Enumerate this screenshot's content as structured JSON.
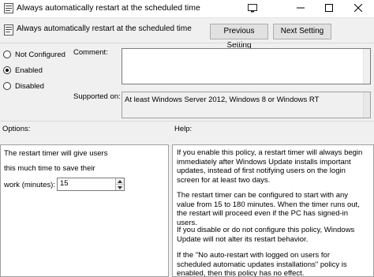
{
  "window": {
    "title": "Always automatically restart at the scheduled time"
  },
  "header": {
    "policy_name": "Always automatically restart at the scheduled time",
    "prev_label": "Previous Setting",
    "next_label": "Next Setting"
  },
  "state": {
    "options": [
      "Not Configured",
      "Enabled",
      "Disabled"
    ],
    "selected": "Enabled"
  },
  "comment": {
    "label": "Comment:",
    "value": ""
  },
  "supported": {
    "label": "Supported on:",
    "value": "At least Windows Server 2012, Windows 8 or Windows RT"
  },
  "options_panel": {
    "label": "Options:",
    "line1": "The restart timer will give users",
    "line2": "this much time to save their",
    "line3": "work (minutes):",
    "minutes_value": "15"
  },
  "help_panel": {
    "label": "Help:",
    "paragraphs": [
      "If you enable this policy, a restart timer will always begin immediately after Windows Update installs important updates, instead of first notifying users on the login screen for at least two days.",
      "The restart timer can be configured to start with any value from 15 to 180 minutes. When the timer runs out, the restart will proceed even if the PC has signed-in users.",
      "If you disable or do not configure this policy, Windows Update will not alter its restart behavior.",
      "If the \"No auto-restart with logged on users for scheduled automatic updates installations\" policy is enabled, then this policy has no effect."
    ]
  },
  "icons": {
    "app": "policy-icon",
    "titlebar_extra": "screen-icon",
    "minimize": "minimize-icon",
    "maximize": "maximize-icon",
    "close": "close-icon"
  }
}
